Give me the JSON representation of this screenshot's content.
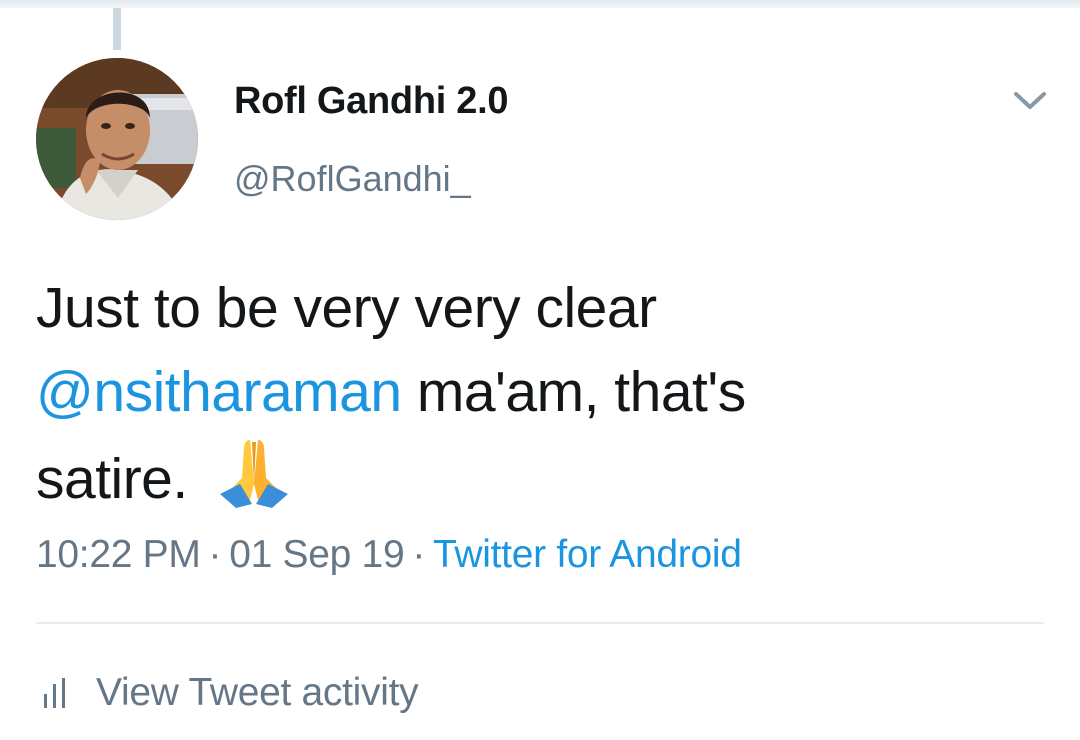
{
  "tweet": {
    "author": {
      "display_name": "Rofl Gandhi 2.0",
      "handle": "@RoflGandhi_"
    },
    "text": {
      "line1": "Just to be very very clear",
      "mention": "@nsitharaman",
      "line2_rest": " ma'am, that's",
      "line3": "satire.",
      "emoji": "folded-hands"
    },
    "time": "10:22 PM",
    "date": "01 Sep 19",
    "separator": "·",
    "source": "Twitter for Android"
  },
  "actions": {
    "view_activity_label": "View Tweet activity"
  },
  "colors": {
    "link": "#1b95e0",
    "secondary_text": "#657786",
    "primary_text": "#14171a"
  }
}
